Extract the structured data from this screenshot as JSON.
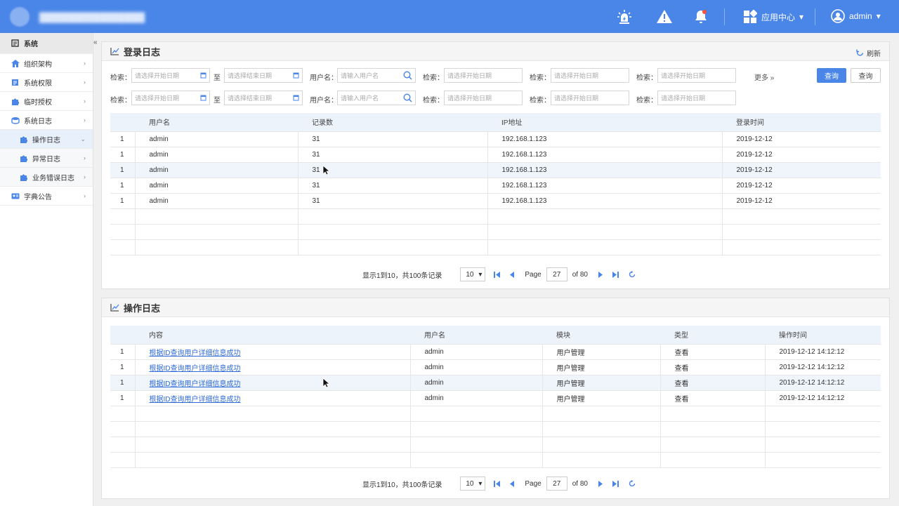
{
  "header": {
    "app_center": "应用中心",
    "user": "admin"
  },
  "sidebar": {
    "items": [
      {
        "label": "系统"
      },
      {
        "label": "组织架构"
      },
      {
        "label": "系统权限"
      },
      {
        "label": "临时授权"
      },
      {
        "label": "系统日志"
      },
      {
        "label": "操作日志"
      },
      {
        "label": "异常日志"
      },
      {
        "label": "业务错误日志"
      },
      {
        "label": "字典公告"
      }
    ],
    "collapse": "«"
  },
  "login_panel": {
    "title": "登录日志",
    "refresh": "刷新",
    "filters": {
      "search_label": "检索：",
      "start_date": "请选择开始日期",
      "to": "至",
      "end_date": "请选择结束日期",
      "username_label": "用户名：",
      "username_placeholder": "请输入用户名",
      "more": "更多",
      "query_primary": "查询",
      "query_secondary": "查询"
    },
    "table": {
      "columns": [
        "",
        "用户名",
        "记录数",
        "IP地址",
        "登录时间"
      ],
      "rows": [
        [
          "1",
          "admin",
          "31",
          "192.168.1.123",
          "2019-12-12"
        ],
        [
          "1",
          "admin",
          "31",
          "192.168.1.123",
          "2019-12-12"
        ],
        [
          "1",
          "admin",
          "31",
          "192.168.1.123",
          "2019-12-12"
        ],
        [
          "1",
          "admin",
          "31",
          "192.168.1.123",
          "2019-12-12"
        ],
        [
          "1",
          "admin",
          "31",
          "192.168.1.123",
          "2019-12-12"
        ]
      ]
    },
    "pager": {
      "summary": "显示1到10，共100条记录",
      "page_size": "10",
      "page_label": "Page",
      "page": "27",
      "of": "of 80"
    }
  },
  "op_panel": {
    "title": "操作日志",
    "table": {
      "columns": [
        "",
        "内容",
        "用户名",
        "模块",
        "类型",
        "操作时间"
      ],
      "rows": [
        [
          "1",
          "根据ID查询用户详细信息成功",
          "admin",
          "用户管理",
          "查看",
          "2019-12-12  14:12:12"
        ],
        [
          "1",
          "根据ID查询用户详细信息成功",
          "admin",
          "用户管理",
          "查看",
          "2019-12-12  14:12:12"
        ],
        [
          "1",
          "根据ID查询用户详细信息成功",
          "admin",
          "用户管理",
          "查看",
          "2019-12-12  14:12:12"
        ],
        [
          "1",
          "根据ID查询用户详细信息成功",
          "admin",
          "用户管理",
          "查看",
          "2019-12-12  14:12:12"
        ]
      ]
    },
    "pager": {
      "summary": "显示1到10，共100条记录",
      "page_size": "10",
      "page_label": "Page",
      "page": "27",
      "of": "of 80"
    }
  },
  "colors": {
    "primary": "#4a86e8",
    "header_row": "#edf3fb",
    "highlight_row": "#f0f5fc",
    "link": "#2f6bd6"
  }
}
